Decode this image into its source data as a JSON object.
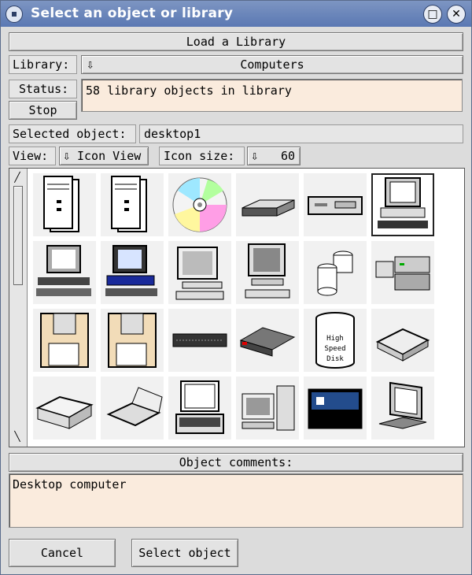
{
  "window": {
    "title": "Select an object or library",
    "maximize_glyph": "□",
    "close_glyph": "✕"
  },
  "load_library_label": "Load a Library",
  "library": {
    "label": "Library:",
    "value": "Computers"
  },
  "status": {
    "label": "Status:",
    "text": "58 library objects in library",
    "stop_label": "Stop"
  },
  "selected": {
    "label": "Selected object:",
    "value": "desktop1"
  },
  "view": {
    "label": "View:",
    "value": "Icon View",
    "icon_size_label": "Icon size:",
    "icon_size_value": "60"
  },
  "disk_text": [
    "High",
    "Speed",
    "Disk"
  ],
  "objects": [
    {
      "icon": "tower-pc-icon"
    },
    {
      "icon": "tower-pc-icon"
    },
    {
      "icon": "cd-icon"
    },
    {
      "icon": "flat-drive-icon"
    },
    {
      "icon": "desktop-box-icon"
    },
    {
      "icon": "desktop-monitor-icon",
      "selected": true
    },
    {
      "icon": "workstation-icon"
    },
    {
      "icon": "color-workstation-icon"
    },
    {
      "icon": "crt-computer-icon"
    },
    {
      "icon": "monitor-computer-icon"
    },
    {
      "icon": "disk-stack-icon"
    },
    {
      "icon": "server-icon"
    },
    {
      "icon": "floppy-icon"
    },
    {
      "icon": "floppy-icon"
    },
    {
      "icon": "rack-unit-icon"
    },
    {
      "icon": "router-icon"
    },
    {
      "icon": "high-speed-disk-icon"
    },
    {
      "icon": "printer-icon"
    },
    {
      "icon": "laser-printer-icon"
    },
    {
      "icon": "laptop-icon"
    },
    {
      "icon": "laptop-open-icon"
    },
    {
      "icon": "pc-tower-combo-icon"
    },
    {
      "icon": "blue-panel-icon"
    },
    {
      "icon": "monitor-side-icon"
    }
  ],
  "comments": {
    "label": "Object comments:",
    "text": "Desktop computer"
  },
  "buttons": {
    "cancel": "Cancel",
    "select": "Select object"
  }
}
